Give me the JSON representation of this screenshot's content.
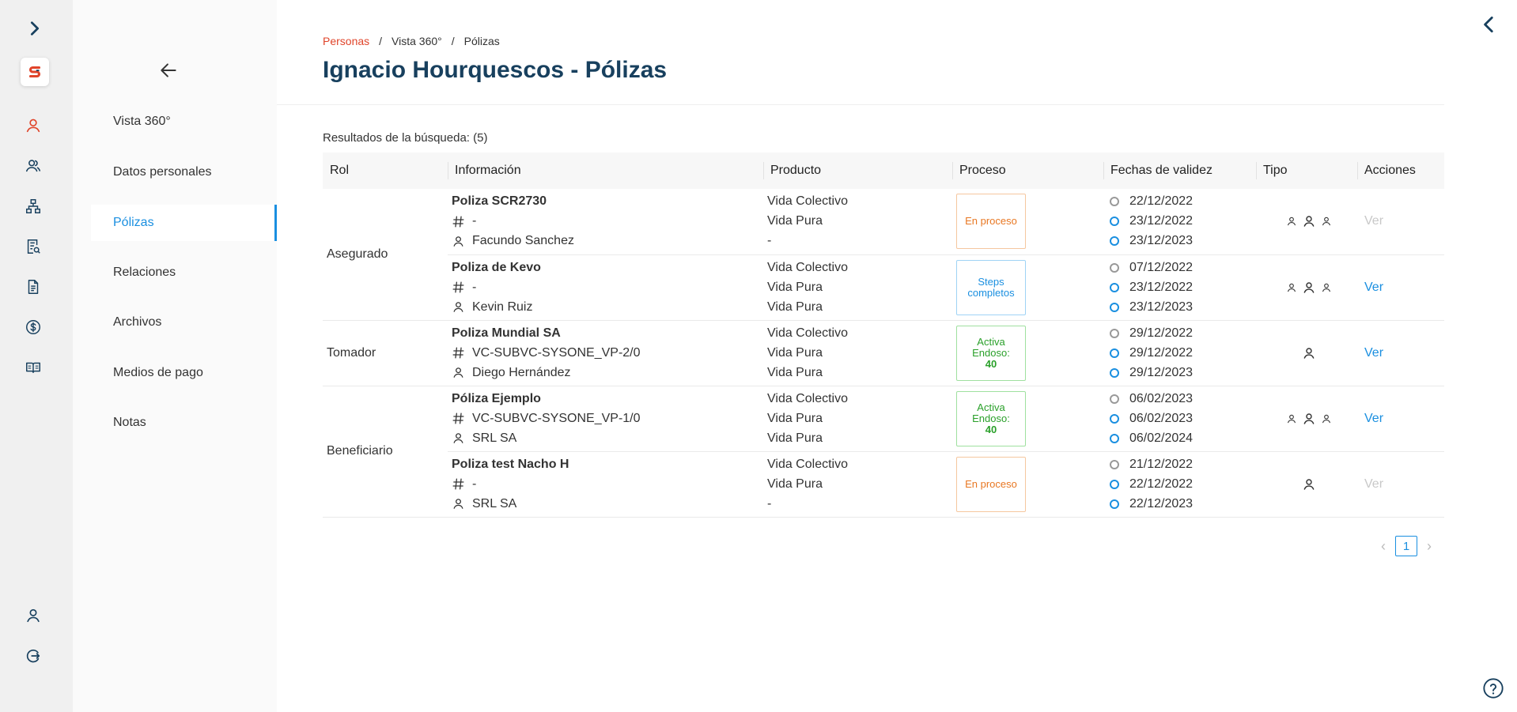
{
  "colors": {
    "accent": "#1a8fe0",
    "brand": "#e0442a",
    "title": "#18405e",
    "orange": "#e87722",
    "green": "#2aa02a"
  },
  "rail": {
    "expand_icon": "chevron-right-icon",
    "logo": "S",
    "items": [
      "person-icon",
      "people-icon",
      "hierarchy-icon",
      "document-search-icon",
      "document-icon",
      "dollar-icon",
      "book-icon"
    ],
    "bottom": [
      "user-icon",
      "logout-icon"
    ]
  },
  "subnav": {
    "back_icon": "arrow-left-icon",
    "items": [
      {
        "label": "Vista 360°"
      },
      {
        "label": "Datos personales"
      },
      {
        "label": "Pólizas",
        "active": true
      },
      {
        "label": "Relaciones"
      },
      {
        "label": "Archivos"
      },
      {
        "label": "Medios de pago"
      },
      {
        "label": "Notas"
      }
    ]
  },
  "breadcrumb": [
    "Personas",
    "Vista 360°",
    "Pólizas"
  ],
  "page_title": "Ignacio Hourquescos - Pólizas",
  "results_label": "Resultados de la búsqueda: (5)",
  "table": {
    "headers": [
      "Rol",
      "Información",
      "Producto",
      "Proceso",
      "Fechas de validez",
      "Tipo",
      "Acciones"
    ],
    "roles": [
      "Asegurado",
      "Tomador",
      "Beneficiario"
    ],
    "rows": [
      {
        "name": "Poliza SCR2730",
        "code": "-",
        "person": "Facundo Sanchez",
        "product": [
          "Vida Colectivo",
          "Vida Pura",
          "-"
        ],
        "process": {
          "text": "En proceso",
          "variant": "orange"
        },
        "dates": [
          "22/12/2022",
          "23/12/2022",
          "23/12/2023"
        ],
        "tipo": "multi",
        "action": "Ver",
        "action_enabled": false
      },
      {
        "name": "Poliza de Kevo",
        "code": "-",
        "person": "Kevin Ruiz",
        "product": [
          "Vida Colectivo",
          "Vida Pura",
          "Vida Pura"
        ],
        "process": {
          "text": "Steps completos",
          "variant": "blue"
        },
        "dates": [
          "07/12/2022",
          "23/12/2022",
          "23/12/2023"
        ],
        "tipo": "multi",
        "action": "Ver",
        "action_enabled": true
      },
      {
        "name": "Poliza Mundial SA",
        "code": "VC-SUBVC-SYSONE_VP-2/0",
        "person": "Diego Hernández",
        "product": [
          "Vida Colectivo",
          "Vida Pura",
          "Vida Pura"
        ],
        "process": {
          "text": "Activa",
          "endoso_label": "Endoso:",
          "endoso": "40",
          "variant": "green"
        },
        "dates": [
          "29/12/2022",
          "29/12/2022",
          "29/12/2023"
        ],
        "tipo": "single",
        "action": "Ver",
        "action_enabled": true
      },
      {
        "name": "Póliza Ejemplo",
        "code": "VC-SUBVC-SYSONE_VP-1/0",
        "person": "SRL SA",
        "product": [
          "Vida Colectivo",
          "Vida Pura",
          "Vida Pura"
        ],
        "process": {
          "text": "Activa",
          "endoso_label": "Endoso:",
          "endoso": "40",
          "variant": "green"
        },
        "dates": [
          "06/02/2023",
          "06/02/2023",
          "06/02/2024"
        ],
        "tipo": "multi",
        "action": "Ver",
        "action_enabled": true
      },
      {
        "name": "Poliza test Nacho H",
        "code": "-",
        "person": "SRL SA",
        "product": [
          "Vida Colectivo",
          "Vida Pura",
          "-"
        ],
        "process": {
          "text": "En proceso",
          "variant": "orange"
        },
        "dates": [
          "21/12/2022",
          "22/12/2022",
          "22/12/2023"
        ],
        "tipo": "single",
        "action": "Ver",
        "action_enabled": false
      }
    ]
  },
  "pagination": {
    "current": "1"
  }
}
